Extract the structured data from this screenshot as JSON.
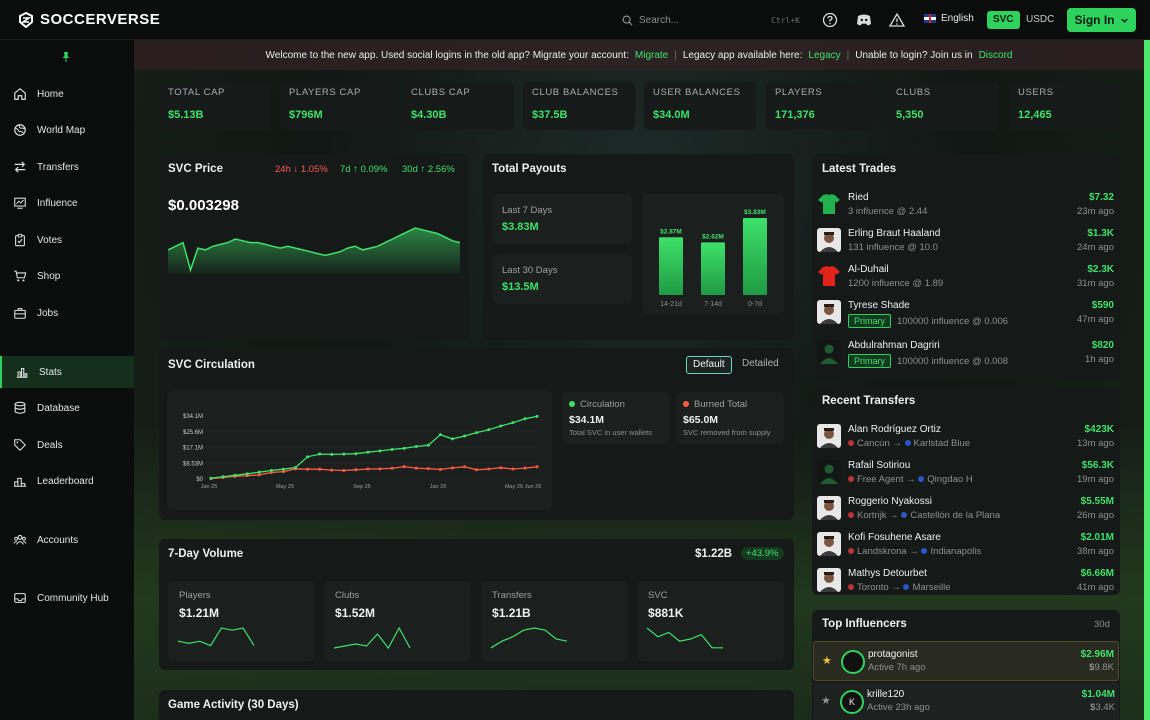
{
  "app": {
    "name": "SOCCERVERSE"
  },
  "topbar": {
    "search_placeholder": "Search...",
    "search_shortcut": "Ctrl+K",
    "language": "English",
    "currency_active": "SVC",
    "currency_other": "USDC",
    "signin_label": "Sign In"
  },
  "sidebar": {
    "items": [
      {
        "label": "Home",
        "icon": "home-icon"
      },
      {
        "label": "World Map",
        "icon": "globe-icon"
      },
      {
        "label": "Transfers",
        "icon": "transfer-icon"
      },
      {
        "label": "Influence",
        "icon": "influence-icon"
      },
      {
        "label": "Votes",
        "icon": "clipboard-icon"
      },
      {
        "label": "Shop",
        "icon": "cart-icon"
      },
      {
        "label": "Jobs",
        "icon": "briefcase-icon"
      },
      {
        "label": "Stats",
        "icon": "bar-chart-icon"
      },
      {
        "label": "Database",
        "icon": "database-icon"
      },
      {
        "label": "Deals",
        "icon": "tag-icon"
      },
      {
        "label": "Leaderboard",
        "icon": "podium-icon"
      },
      {
        "label": "Accounts",
        "icon": "users-icon"
      },
      {
        "label": "Community Hub",
        "icon": "inbox-icon"
      }
    ],
    "active": "Stats"
  },
  "banner": {
    "text1": "Welcome to the new app. Used social logins in the old app? Migrate your account:",
    "link1": "Migrate",
    "text2": "Legacy app available here:",
    "link2": "Legacy",
    "text3": "Unable to login? Join us in",
    "link3": "Discord"
  },
  "stats": [
    {
      "label": "TOTAL CAP",
      "value": "5.13B"
    },
    {
      "label": "PLAYERS CAP",
      "value": "796M"
    },
    {
      "label": "CLUBS CAP",
      "value": "4.30B"
    },
    {
      "label": "CLUB BALANCES",
      "value": "37.5B"
    },
    {
      "label": "USER BALANCES",
      "value": "34.0M"
    },
    {
      "label": "PLAYERS",
      "value": "171,376"
    },
    {
      "label": "CLUBS",
      "value": "5,350"
    },
    {
      "label": "USERS",
      "value": "12,465"
    }
  ],
  "svc_price": {
    "title": "SVC Price",
    "change_24h": "24h ↓ 1.05%",
    "change_7d": "7d ↑ 0.09%",
    "change_30d": "30d ↑ 2.56%",
    "price": "$0.003298",
    "sparkline": [
      62,
      66,
      70,
      40,
      64,
      62,
      66,
      68,
      70,
      74,
      72,
      70,
      70,
      68,
      66,
      64,
      66,
      64,
      62,
      60,
      58,
      56,
      58,
      60,
      64,
      66,
      62,
      64,
      66,
      70,
      74,
      78,
      82,
      86,
      84,
      82,
      80,
      76,
      72,
      70
    ]
  },
  "payouts": {
    "title": "Total Payouts",
    "last7_label": "Last 7 Days",
    "last7_value": "3.83M",
    "last30_label": "Last 30 Days",
    "last30_value": "13.5M",
    "bars": [
      {
        "label": "14-21d",
        "value": 2.87,
        "display": "2.87M"
      },
      {
        "label": "7-14d",
        "value": 2.62,
        "display": "2.62M"
      },
      {
        "label": "0-7d",
        "value": 3.83,
        "display": "3.83M"
      }
    ]
  },
  "circulation": {
    "title": "SVC Circulation",
    "tab_default": "Default",
    "tab_detailed": "Detailed",
    "y_ticks": [
      "34.1M",
      "25.6M",
      "17.1M",
      "8.53M",
      "0"
    ],
    "x_ticks": [
      "Jan 25",
      "May 25",
      "Sep 25",
      "Jan 26",
      "May 26",
      "Jun 26"
    ],
    "circ_series": [
      0.5,
      1.2,
      2.0,
      2.8,
      3.7,
      4.6,
      5.3,
      6.2,
      12.0,
      13.5,
      13.3,
      13.5,
      13.7,
      14.5,
      15.2,
      16.0,
      16.6,
      17.6,
      18.3,
      24.0,
      21.7,
      23.3,
      25.1,
      26.7,
      28.7,
      30.5,
      32.6,
      33.9
    ],
    "burn_series": [
      0.2,
      0.8,
      1.4,
      1.8,
      2.2,
      3.5,
      4.0,
      5.5,
      5.3,
      5.3,
      4.8,
      4.6,
      5.0,
      5.4,
      5.5,
      5.8,
      6.7,
      5.9,
      5.6,
      5.2,
      6.0,
      6.6,
      5.0,
      5.4,
      6.1,
      5.4,
      5.9,
      6.6
    ],
    "y_max": 34.1,
    "legend_circ_label": "Circulation",
    "legend_circ_value": "34.1M",
    "legend_circ_sub": "Total SVC in user wallets",
    "legend_burn_label": "Burned Total",
    "legend_burn_value": "65.0M",
    "legend_burn_sub": "SVC removed from supply",
    "colors": {
      "circ": "#3ee16a",
      "burn": "#ff5a45"
    }
  },
  "volume": {
    "title": "7-Day Volume",
    "total": "1.22B",
    "change": "+43.9%",
    "boxes": [
      {
        "label": "Players",
        "value": "1.21M",
        "spark": [
          8,
          6,
          8,
          4,
          20,
          18,
          20,
          4
        ]
      },
      {
        "label": "Clubs",
        "value": "1.52M",
        "spark": [
          2,
          4,
          6,
          4,
          16,
          2,
          22,
          2
        ]
      },
      {
        "label": "Transfers",
        "value": "1.21B",
        "spark": [
          2,
          8,
          12,
          18,
          20,
          18,
          10,
          8
        ]
      },
      {
        "label": "SVC",
        "value": "881K",
        "spark": [
          20,
          12,
          16,
          8,
          10,
          14,
          2,
          2
        ]
      }
    ]
  },
  "game_activity": {
    "title": "Game Activity (30 Days)"
  },
  "latest_trades": {
    "title": "Latest Trades",
    "items": [
      {
        "name": "Ried",
        "detail": "3 influence @ 2.44",
        "amount": "7.32",
        "ago": "23m ago",
        "avatar": "green-shirt",
        "primary": false
      },
      {
        "name": "Erling Braut Haaland",
        "detail": "131 influence @ 10.0",
        "amount": "1.3K",
        "ago": "24m ago",
        "avatar": "photo",
        "primary": false
      },
      {
        "name": "Al-Duhail",
        "detail": "1200 influence @ 1.89",
        "amount": "2.3K",
        "ago": "31m ago",
        "avatar": "red-shirt",
        "primary": false
      },
      {
        "name": "Tyrese Shade",
        "detail": "100000 influence @ 0.006",
        "amount": "590",
        "ago": "47m ago",
        "avatar": "photo",
        "primary": true
      },
      {
        "name": "Abdulrahman Dagriri",
        "detail": "100000 influence @ 0.008",
        "amount": "820",
        "ago": "1h ago",
        "avatar": "silhouette",
        "primary": true
      }
    ],
    "primary_label": "Primary"
  },
  "recent_transfers": {
    "title": "Recent Transfers",
    "items": [
      {
        "name": "Alan Rodríguez Ortiz",
        "from": "Cancún",
        "to": "Karlstad Blue",
        "amount": "423K",
        "ago": "13m ago",
        "avatar": "photo"
      },
      {
        "name": "Rafail Sotiriou",
        "from": "Free Agent",
        "to": "Qingdao H",
        "amount": "56.3K",
        "ago": "19m ago",
        "avatar": "silhouette"
      },
      {
        "name": "Roggerio Nyakossi",
        "from": "Kortrijk",
        "to": "Castellón de la Plana",
        "amount": "5.55M",
        "ago": "26m ago",
        "avatar": "photo"
      },
      {
        "name": "Kofi Fosuhene Asare",
        "from": "Landskrona",
        "to": "Indianapolis",
        "amount": "2.01M",
        "ago": "38m ago",
        "avatar": "photo"
      },
      {
        "name": "Mathys Detourbet",
        "from": "Toronto",
        "to": "Marseille",
        "amount": "6.66M",
        "ago": "41m ago",
        "avatar": "photo"
      }
    ]
  },
  "top_influencers": {
    "title": "Top Influencers",
    "period": "30d",
    "items": [
      {
        "name": "protagonist",
        "active": "Active 7h ago",
        "amount": "2.96M",
        "sub": "9.8K",
        "initial": ""
      },
      {
        "name": "krille120",
        "active": "Active 23h ago",
        "amount": "1.04M",
        "sub": "3.4K",
        "initial": "K"
      }
    ]
  }
}
